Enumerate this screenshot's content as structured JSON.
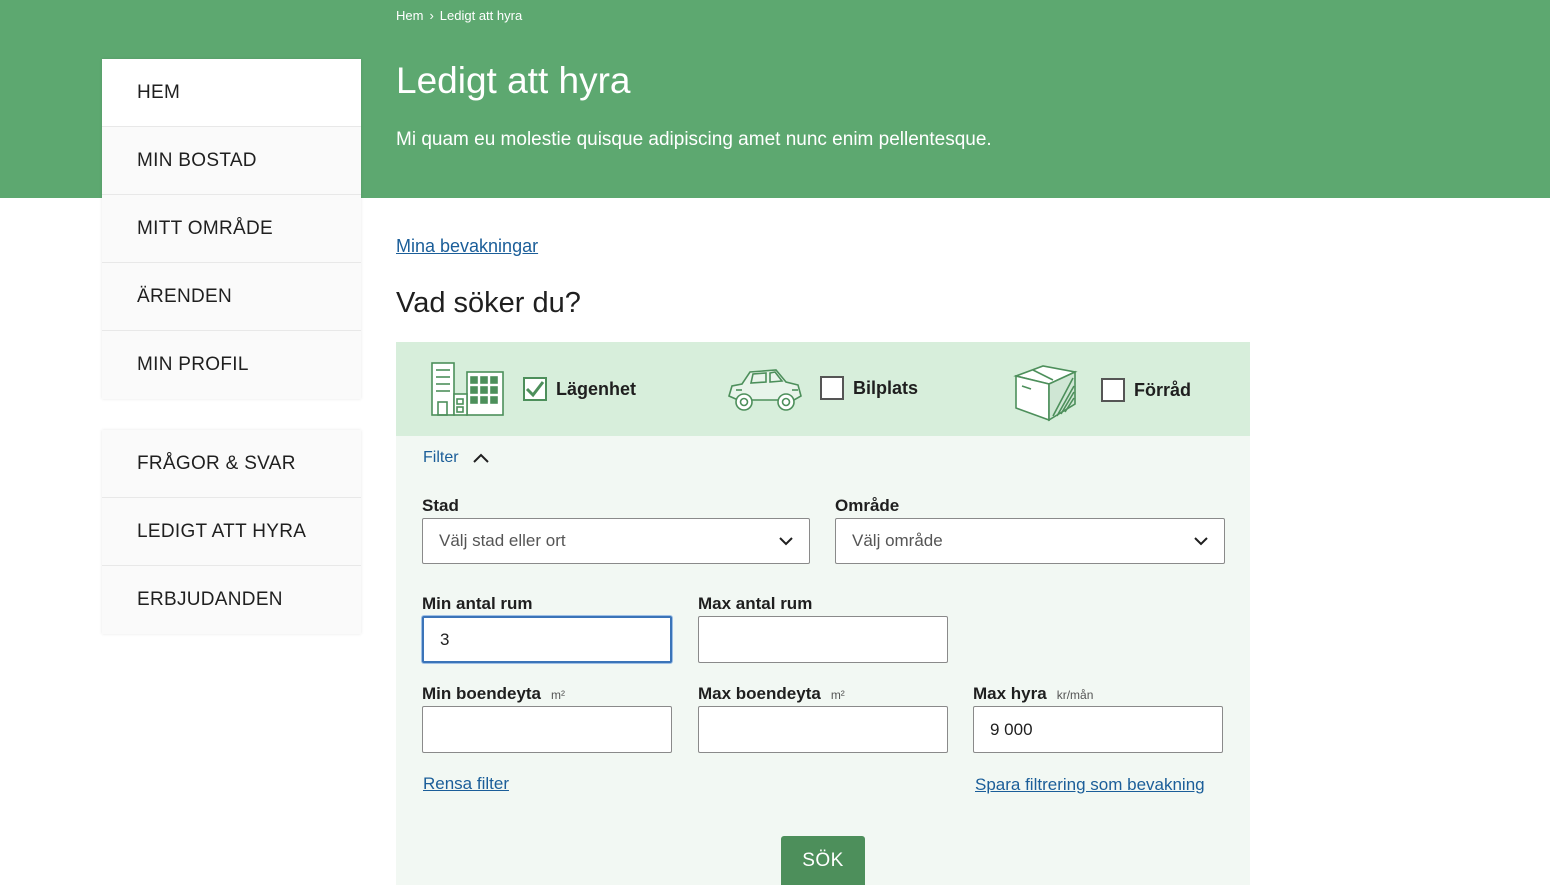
{
  "breadcrumb": {
    "home": "Hem",
    "separator": "›",
    "current": "Ledigt att hyra"
  },
  "header": {
    "title": "Ledigt att hyra",
    "lead": "Mi quam eu molestie quisque adipiscing amet nunc enim pellentesque."
  },
  "nav": {
    "primary": [
      "HEM",
      "MIN BOSTAD",
      "MITT OMRÅDE",
      "ÄRENDEN",
      "MIN PROFIL"
    ],
    "secondary": [
      "FRÅGOR & SVAR",
      "LEDIGT ATT HYRA",
      "ERBJUDANDEN"
    ]
  },
  "links": {
    "my_watches": "Mina bevakningar"
  },
  "search": {
    "heading": "Vad söker du?",
    "types": [
      {
        "label": "Lägenhet",
        "checked": true,
        "icon": "apartment-buildings-icon"
      },
      {
        "label": "Bilplats",
        "checked": false,
        "icon": "car-icon"
      },
      {
        "label": "Förråd",
        "checked": false,
        "icon": "storage-box-icon"
      }
    ],
    "filter_label": "Filter",
    "city": {
      "label": "Stad",
      "value": "Välj stad eller ort"
    },
    "area": {
      "label": "Område",
      "value": "Välj område"
    },
    "min_rooms": {
      "label": "Min antal rum",
      "value": "3"
    },
    "max_rooms": {
      "label": "Max antal rum",
      "value": ""
    },
    "min_size": {
      "label": "Min boendeyta",
      "unit": "m²",
      "value": ""
    },
    "max_size": {
      "label": "Max boendeyta",
      "unit": "m²",
      "value": ""
    },
    "max_rent": {
      "label": "Max hyra",
      "unit": "kr/mån",
      "value": "9 000"
    },
    "clear_filter": "Rensa filter",
    "save_filter": "Spara filtrering som bevakning",
    "submit": "SÖK"
  },
  "colors": {
    "hero_green": "#5da870",
    "panel_green": "#d7eedb",
    "button_green": "#4d8f5b",
    "link_blue": "#1b5e99"
  }
}
